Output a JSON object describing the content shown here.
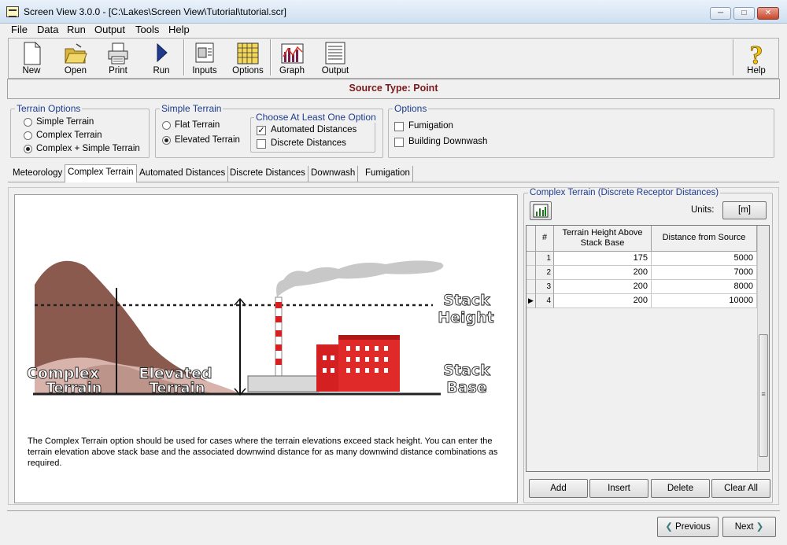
{
  "window": {
    "title": "Screen View 3.0.0 - [C:\\Lakes\\Screen View\\Tutorial\\tutorial.scr]",
    "minimize": "─",
    "maximize": "□",
    "close": "✕"
  },
  "menu": [
    "File",
    "Data",
    "Run",
    "Output",
    "Tools",
    "Help"
  ],
  "toolbar": {
    "new": "New",
    "open": "Open",
    "print": "Print",
    "run": "Run",
    "inputs": "Inputs",
    "options": "Options",
    "graph": "Graph",
    "output": "Output",
    "help": "Help"
  },
  "source_type": "Source Type: Point",
  "terrain_options": {
    "title": "Terrain Options",
    "items": [
      "Simple Terrain",
      "Complex Terrain",
      "Complex + Simple Terrain"
    ],
    "selected": "Complex + Simple Terrain"
  },
  "simple_terrain": {
    "title": "Simple Terrain",
    "items": [
      "Flat Terrain",
      "Elevated Terrain"
    ],
    "selected": "Elevated Terrain",
    "choose": {
      "title": "Choose At Least One Option",
      "automated": "Automated Distances",
      "automated_checked": true,
      "discrete": "Discrete Distances",
      "discrete_checked": false
    }
  },
  "options": {
    "title": "Options",
    "fumigation": "Fumigation",
    "fumigation_checked": false,
    "building": "Building Downwash",
    "building_checked": false
  },
  "tabs": [
    "Meteorology",
    "Complex Terrain",
    "Automated Distances",
    "Discrete Distances",
    "Downwash",
    "Fumigation"
  ],
  "active_tab": "Complex Terrain",
  "illustration": {
    "complex": "Complex",
    "complex2": "Terrain",
    "elevated": "Elevated",
    "elevated2": "Terrain",
    "stack": "Stack",
    "height": "Height",
    "stack2": "Stack",
    "base": "Base"
  },
  "description": "The Complex Terrain option should be used for cases where the terrain elevations exceed stack height. You can enter the terrain elevation above stack base and the associated downwind distance for as many downwind distance combinations as required.",
  "receptors": {
    "title": "Complex Terrain (Discrete Receptor Distances)",
    "units_label": "Units:",
    "units_value": "[m]",
    "col_num": "#",
    "col_height": "Terrain Height Above Stack Base",
    "col_dist": "Distance from Source",
    "rows": [
      {
        "n": "1",
        "h": "175",
        "d": "5000"
      },
      {
        "n": "2",
        "h": "200",
        "d": "7000"
      },
      {
        "n": "3",
        "h": "200",
        "d": "8000"
      },
      {
        "n": "4",
        "h": "200",
        "d": "10000"
      }
    ],
    "add": "Add",
    "insert": "Insert",
    "delete": "Delete",
    "clear": "Clear All"
  },
  "nav": {
    "previous": "Previous",
    "next": "Next"
  }
}
